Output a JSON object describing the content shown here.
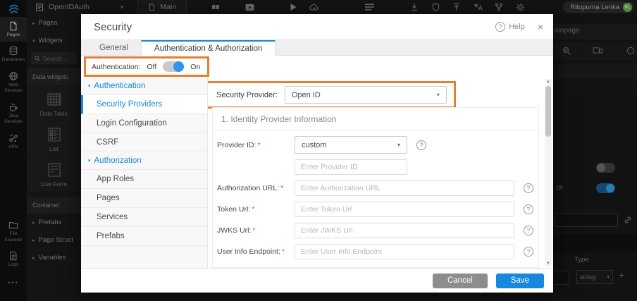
{
  "colors": {
    "accent_blue": "#1789d6",
    "highlight_orange": "#e87f2f",
    "toggle_on_blue": "#2e95e8",
    "save_blue": "#1788dd",
    "avatar_green": "#55843a"
  },
  "topbar": {
    "project_name": "OpenIDAuth",
    "page_tab": "Main",
    "user_name": "Ritupurna Lenka",
    "user_initials": "RL"
  },
  "rail": {
    "items": [
      {
        "label": "Pages"
      },
      {
        "label": "Databases"
      },
      {
        "label": "Web Services"
      },
      {
        "label": "Java Services"
      },
      {
        "label": "APIs"
      },
      {
        "label": "File Explorer"
      },
      {
        "label": "Logs"
      }
    ],
    "overflow": "•••"
  },
  "panel": {
    "pages_label": "Pages",
    "widgets_label": "Widgets",
    "search_placeholder": "Search...",
    "data_widgets_title": "Data widgets",
    "widgets": [
      {
        "label": "Data Table"
      },
      {
        "label": "List"
      },
      {
        "label": "Live Form"
      }
    ],
    "container_title": "Container",
    "tree_items": [
      {
        "label": "Prefabs"
      },
      {
        "label": "Page Struct"
      },
      {
        "label": "Variables"
      }
    ]
  },
  "canvas": {
    "page_label": "ainpage",
    "toggle_label": "ch",
    "type_label": "Type",
    "type_value": "string",
    "plus": "+"
  },
  "modal": {
    "title": "Security",
    "help_label": "Help",
    "close": "×",
    "tabs": [
      {
        "label": "General"
      },
      {
        "label": "Authentication & Authorization"
      }
    ],
    "auth": {
      "label": "Authentication:",
      "off": "Off",
      "on": "On",
      "state": "on"
    },
    "nav": [
      {
        "label": "Authentication",
        "type": "section"
      },
      {
        "label": "Security Providers",
        "selected": true
      },
      {
        "label": "Login Configuration"
      },
      {
        "label": "CSRF"
      },
      {
        "label": "Authorization",
        "type": "section"
      },
      {
        "label": "App Roles"
      },
      {
        "label": "Pages"
      },
      {
        "label": "Services"
      },
      {
        "label": "Prefabs"
      }
    ],
    "provider": {
      "label": "Security Provider:",
      "value": "Open ID"
    },
    "section_title": "1. Identity Provider Information",
    "required_mark": "*",
    "fields": [
      {
        "label": "Provider ID:",
        "value": "custom"
      },
      {
        "placeholder": "Enter Provider ID"
      },
      {
        "label": "Authorization URL:",
        "placeholder": "Enter Authorization URL"
      },
      {
        "label": "Token Url:",
        "placeholder": "Enter Token Url"
      },
      {
        "label": "JWKS Url:",
        "placeholder": "Enter JWKS Url"
      },
      {
        "label": "User Info Endpoint:",
        "placeholder": "Enter User Info Endpoint"
      }
    ],
    "footer": {
      "cancel": "Cancel",
      "save": "Save"
    }
  }
}
